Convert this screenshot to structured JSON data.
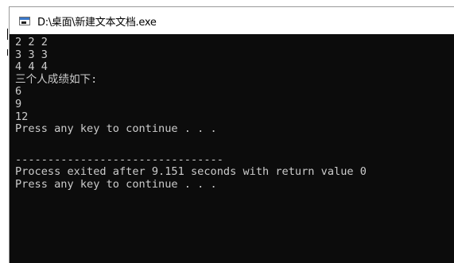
{
  "window": {
    "title": "D:\\桌面\\新建文本文档.exe"
  },
  "console": {
    "lines": [
      "2 2 2",
      "3 3 3",
      "4 4 4",
      "三个人成绩如下:",
      "6",
      "9",
      "12",
      "Press any key to continue . . ."
    ],
    "footer_lines": [
      "--------------------------------",
      "Process exited after 9.151 seconds with return value 0",
      "Press any key to continue . . ."
    ],
    "text_color": "#cccccc",
    "background_color": "#0c0c0c"
  }
}
